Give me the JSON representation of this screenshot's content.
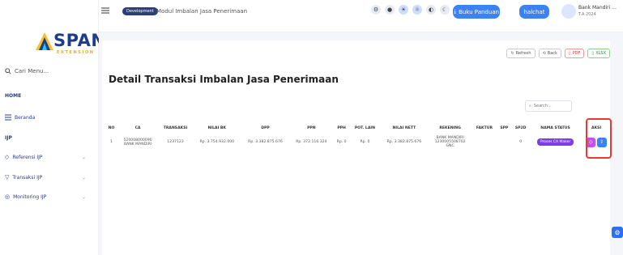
{
  "logo": {
    "name": "SPAN",
    "tagline": "EXTENSION"
  },
  "sidebar": {
    "search_placeholder": "Cari Menu...",
    "sections": {
      "home": "HOME",
      "ijp": "IJP"
    },
    "items": [
      {
        "label": "Beranda",
        "icon": "menu-icon"
      },
      {
        "label": "Referensi IJP",
        "icon": "tag-icon"
      },
      {
        "label": "Transaksi IJP",
        "icon": "cart-icon"
      },
      {
        "label": "Monitoring IJP",
        "icon": "target-icon"
      }
    ]
  },
  "topbar": {
    "environment": "Development",
    "module_title": "Modul Imbalan Jasa Penerimaan",
    "buku_panduan": "Buku Panduan",
    "halchat": "halchat",
    "user_name": "Bank Mandiri ...",
    "user_sub": "T.A 2024"
  },
  "toolbar": {
    "refresh": "Refresh",
    "back": "Back",
    "pdf": "PDF",
    "xlsx": "XLSX"
  },
  "page_title": "Detail Transaksi Imbalan Jasa Penerimaan",
  "search": {
    "placeholder": "Search..."
  },
  "table": {
    "headers": [
      "NO",
      "CA",
      "TRANSAKSI",
      "NILAI BK",
      "DPP",
      "PPN",
      "PPH",
      "POT. LAIN",
      "NILAI NETT",
      "REKENING",
      "FAKTUR",
      "SPP",
      "SP2D",
      "NAMA STATUS",
      "AKSI"
    ],
    "rows": [
      {
        "no": "1",
        "ca_code": "520008000090",
        "ca_name": "BANK MANDIRI",
        "transaksi": "1237123",
        "nilai_bk": "Rp. 3.754.932.000",
        "dpp": "Rp. 3.382.875.676",
        "ppn": "Rp. 372.116.324",
        "pph": "Rp. 0",
        "pot_lain": "Rp. 0",
        "nilai_nett": "Rp. 3.382.875.676",
        "rekening_bank": "BANK MANDIRI",
        "rekening_no": "1230005508702",
        "rekening_extra": "GNC",
        "faktur": "",
        "spp": "",
        "sp2d": "0",
        "status": "Proses CA Maker"
      }
    ]
  },
  "colors": {
    "primary": "#3b82f6",
    "status": "#7b3fe4",
    "highlight": "#e53935"
  }
}
